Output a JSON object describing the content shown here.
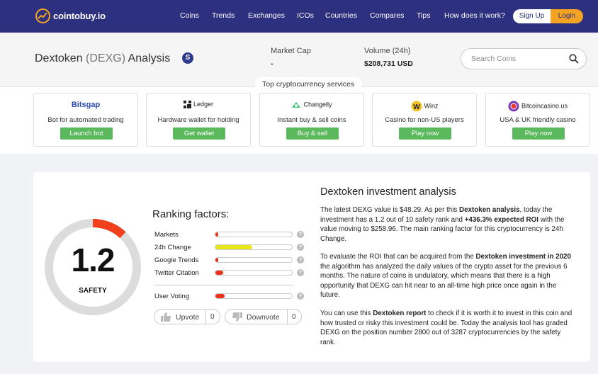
{
  "nav": {
    "logo": "cointobuy.io",
    "links": [
      "Coins",
      "Trends",
      "Exchanges",
      "ICOs",
      "Countries",
      "Compares",
      "Tips",
      "How does it work?"
    ],
    "signup": "Sign Up",
    "login": "Login"
  },
  "header": {
    "title_name": "Dextoken",
    "title_symbol": "(DEXG)",
    "title_suffix": "Analysis",
    "coin_icon": "S",
    "market_cap_label": "Market Cap",
    "market_cap_value": "-",
    "volume_label": "Volume (24h)",
    "volume_value": "$208,731 USD",
    "search_placeholder": "Search Coins"
  },
  "services": {
    "label": "Top cryptocurrency services",
    "cards": [
      {
        "name": "Bitsgap",
        "desc": "Bot for automated trading",
        "button": "Launch bot"
      },
      {
        "name": "Ledger",
        "desc": "Hardware wallet for holding",
        "button": "Get wallet"
      },
      {
        "name": "Changelly",
        "desc": "Instant buy & sell coins",
        "button": "Buy & sell"
      },
      {
        "name": "Winz",
        "desc": "Casino for non-US players",
        "button": "Play now"
      },
      {
        "name": "Bitcoincasino.us",
        "desc": "USA & UK friendly casino",
        "button": "Play now"
      }
    ]
  },
  "safety": {
    "value": "1.2",
    "label": "SAFETY",
    "max": 10
  },
  "ranking": {
    "title": "Ranking factors:",
    "rows": [
      {
        "label": "Markets",
        "fill": 0.02,
        "color": "#e8321c"
      },
      {
        "label": "24h Change",
        "fill": 0.48,
        "color": "#e6e619"
      },
      {
        "label": "Google Trends",
        "fill": 0.02,
        "color": "#e8321c"
      },
      {
        "label": "Twitter Citation",
        "fill": 0.1,
        "color": "#e8321c"
      }
    ],
    "user_voting": {
      "label": "User Voting",
      "fill": 0.12,
      "color": "#e8321c"
    },
    "upvote_label": "Upvote",
    "upvote_count": "0",
    "downvote_label": "Downvote",
    "downvote_count": "0"
  },
  "analysis": {
    "title": "Dextoken investment analysis",
    "p1_a": "The latest DEXG value is $48.29. As per this ",
    "p1_b": "Dextoken analysis",
    "p1_c": ", today the investment has a 1.2 out of 10 safety rank and ",
    "p1_d": "+436.3% expected ROI",
    "p1_e": " with the value moving to $258.96. The main ranking factor for this cryptocurrency is 24h Change.",
    "p2_a": "To evaluate the ROI that can be acquired from the ",
    "p2_b": "Dextoken investment in 2020",
    "p2_c": " the algorithm has analyzed the daily values of the crypto asset for the previous 6 months. The nature of coins is undulatory, which means that there is a high opportunity that DEXG can hit near to an all-time high price once again in the future.",
    "p3_a": "You can use this ",
    "p3_b": "Dextoken report",
    "p3_c": " to check if it is worth it to invest in this coin and how trusted or risky this investment could be. Today the analysis tool has graded DEXG on the position number 2800 out of 3287 cryptocurrencies by the safety rank."
  }
}
